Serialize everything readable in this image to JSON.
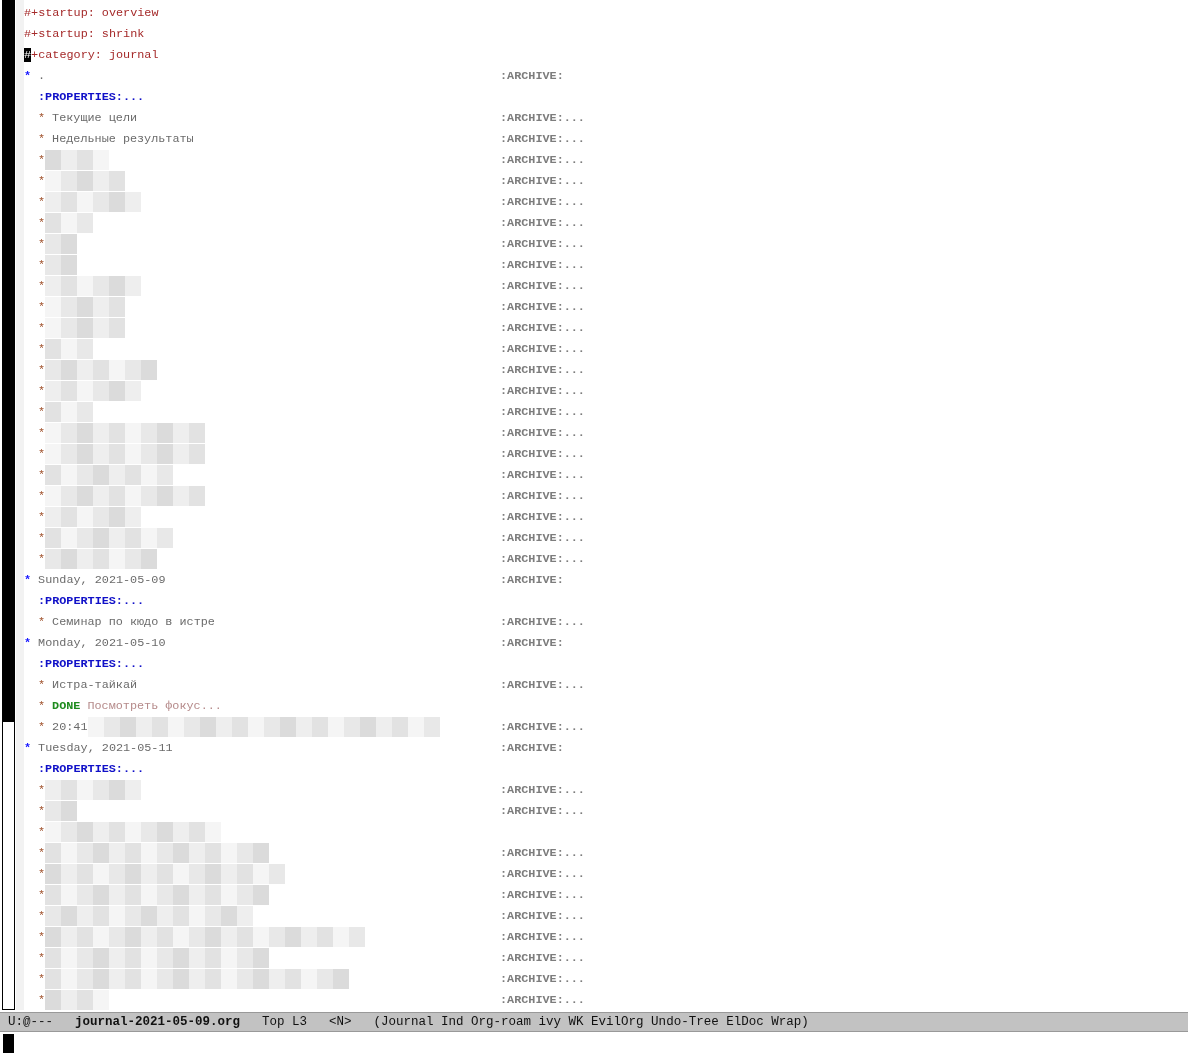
{
  "keywords": [
    {
      "text": "#+startup: overview",
      "cursor": false
    },
    {
      "text": "#+startup: shrink",
      "cursor": false
    },
    {
      "text": "#+category: journal",
      "cursor": true
    }
  ],
  "headings": [
    {
      "star": "*",
      "title": ".",
      "tag": ":ARCHIVE:",
      "properties": ":PROPERTIES:...",
      "children": [
        {
          "star": "*",
          "title": "Текущие цели",
          "tag": ":ARCHIVE:..."
        },
        {
          "star": "*",
          "title": "Недельные результаты",
          "tag": ":ARCHIVE:..."
        },
        {
          "star": "*",
          "redacted": true,
          "tag": ":ARCHIVE:..."
        },
        {
          "star": "*",
          "redacted": true,
          "tag": ":ARCHIVE:..."
        },
        {
          "star": "*",
          "redacted": true,
          "tag": ":ARCHIVE:..."
        },
        {
          "star": "*",
          "redacted": true,
          "tag": ":ARCHIVE:..."
        },
        {
          "star": "*",
          "redacted": true,
          "tag": ":ARCHIVE:..."
        },
        {
          "star": "*",
          "redacted": true,
          "tag": ":ARCHIVE:..."
        },
        {
          "star": "*",
          "redacted": true,
          "tag": ":ARCHIVE:..."
        },
        {
          "star": "*",
          "redacted": true,
          "tag": ":ARCHIVE:..."
        },
        {
          "star": "*",
          "redacted": true,
          "tag": ":ARCHIVE:..."
        },
        {
          "star": "*",
          "redacted": true,
          "tag": ":ARCHIVE:..."
        },
        {
          "star": "*",
          "redacted": true,
          "tag": ":ARCHIVE:..."
        },
        {
          "star": "*",
          "redacted": true,
          "tag": ":ARCHIVE:..."
        },
        {
          "star": "*",
          "redacted": true,
          "tag": ":ARCHIVE:..."
        },
        {
          "star": "*",
          "redacted": true,
          "tag": ":ARCHIVE:..."
        },
        {
          "star": "*",
          "redacted": true,
          "tag": ":ARCHIVE:..."
        },
        {
          "star": "*",
          "redacted": true,
          "tag": ":ARCHIVE:..."
        },
        {
          "star": "*",
          "redacted": true,
          "tag": ":ARCHIVE:..."
        },
        {
          "star": "*",
          "redacted": true,
          "tag": ":ARCHIVE:..."
        },
        {
          "star": "*",
          "redacted": true,
          "tag": ":ARCHIVE:..."
        },
        {
          "star": "*",
          "redacted": true,
          "tag": ":ARCHIVE:..."
        }
      ]
    },
    {
      "star": "*",
      "title": "Sunday, 2021-05-09",
      "tag": ":ARCHIVE:",
      "properties": ":PROPERTIES:...",
      "children": [
        {
          "star": "*",
          "title": "Семинар по кюдо в истре",
          "tag": ":ARCHIVE:..."
        }
      ]
    },
    {
      "star": "*",
      "title": "Monday, 2021-05-10",
      "tag": ":ARCHIVE:",
      "properties": ":PROPERTIES:...",
      "children": [
        {
          "star": "*",
          "title": "Истра-тайкай",
          "tag": ":ARCHIVE:..."
        },
        {
          "star": "*",
          "todo": "DONE",
          "title": "Посмотреть фокус..."
        },
        {
          "star": "*",
          "title": "20:41",
          "redacted": true,
          "tag": ":ARCHIVE:..."
        }
      ]
    },
    {
      "star": "*",
      "title": "Tuesday, 2021-05-11",
      "tag": ":ARCHIVE:",
      "properties": ":PROPERTIES:...",
      "children": [
        {
          "star": "*",
          "redacted": true,
          "tag": ":ARCHIVE:..."
        },
        {
          "star": "*",
          "redacted": true,
          "tag": ":ARCHIVE:..."
        },
        {
          "star": "*",
          "redacted": true
        },
        {
          "star": "*",
          "redacted": true,
          "tag": ":ARCHIVE:..."
        },
        {
          "star": "*",
          "redacted": true,
          "tag": ":ARCHIVE:..."
        },
        {
          "star": "*",
          "redacted": true,
          "tag": ":ARCHIVE:..."
        },
        {
          "star": "*",
          "redacted": true,
          "tag": ":ARCHIVE:..."
        },
        {
          "star": "*",
          "redacted": true,
          "tag": ":ARCHIVE:..."
        },
        {
          "star": "*",
          "redacted": true,
          "tag": ":ARCHIVE:..."
        },
        {
          "star": "*",
          "redacted": true,
          "tag": ":ARCHIVE:..."
        },
        {
          "star": "*",
          "redacted": true,
          "tag": ":ARCHIVE:..."
        }
      ]
    }
  ],
  "mode_line": {
    "state": "U:@---",
    "buffer": "journal-2021-05-09.org",
    "position": "Top L3",
    "evil_state": "<N>",
    "modes": "(Journal Ind Org-roam ivy WK EvilOrg Undo-Tree ElDoc Wrap)"
  }
}
